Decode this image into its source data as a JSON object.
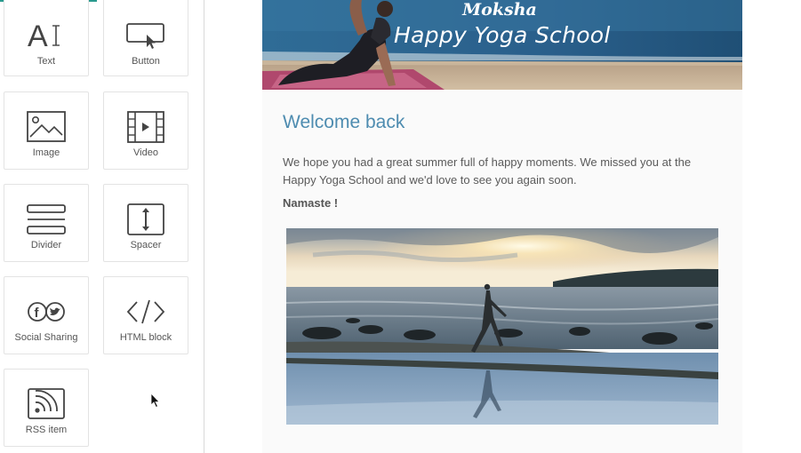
{
  "sidebar": {
    "blocks": [
      {
        "id": "text",
        "label": "Text",
        "icon": "text-icon"
      },
      {
        "id": "button",
        "label": "Button",
        "icon": "button-icon"
      },
      {
        "id": "image",
        "label": "Image",
        "icon": "image-icon"
      },
      {
        "id": "video",
        "label": "Video",
        "icon": "video-icon"
      },
      {
        "id": "divider",
        "label": "Divider",
        "icon": "divider-icon"
      },
      {
        "id": "spacer",
        "label": "Spacer",
        "icon": "spacer-icon"
      },
      {
        "id": "social",
        "label": "Social Sharing",
        "icon": "social-sharing-icon"
      },
      {
        "id": "html",
        "label": "HTML block",
        "icon": "code-icon"
      },
      {
        "id": "rss",
        "label": "RSS item",
        "icon": "rss-icon"
      }
    ]
  },
  "email": {
    "brand": "Moksha",
    "school_name": "Happy Yoga School",
    "heading": "Welcome back",
    "body": "We hope you had a great summer full of happy moments. We missed you at the Happy Yoga School and we'd love to see you again soon.",
    "signoff": "Namaste !"
  },
  "colors": {
    "accent": "#2a9a8e",
    "heading": "#4e8cb0",
    "body_text": "#5a5a5a"
  }
}
